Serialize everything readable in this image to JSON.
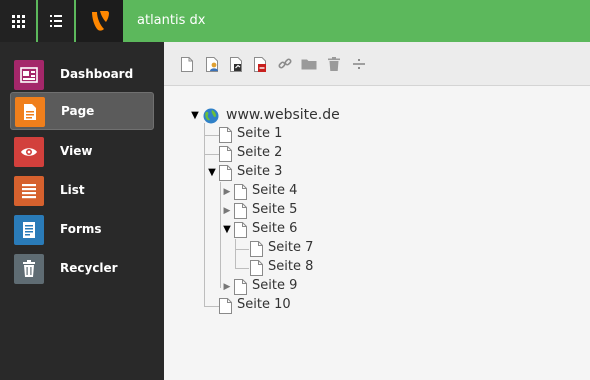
{
  "topbar": {
    "site_name": "atlantis dx",
    "grid_icon": "module-grid-icon",
    "list_icon": "list-icon",
    "logo": "typo3-logo"
  },
  "sidebar": {
    "items": [
      {
        "label": "Dashboard",
        "icon": "dashboard-icon",
        "color": "#a4276a",
        "active": false
      },
      {
        "label": "Page",
        "icon": "page-icon",
        "color": "#f07f1c",
        "active": true
      },
      {
        "label": "View",
        "icon": "eye-icon",
        "color": "#d2403c",
        "active": false
      },
      {
        "label": "List",
        "icon": "list-icon",
        "color": "#d6612e",
        "active": false
      },
      {
        "label": "Forms",
        "icon": "forms-icon",
        "color": "#2a7bb8",
        "active": false
      },
      {
        "label": "Recycler",
        "icon": "trash-icon",
        "color": "#5f6c73",
        "active": false
      }
    ]
  },
  "toolbar": {
    "tools": [
      "new-page-icon",
      "new-page-user-icon",
      "move-page-icon",
      "delete-page-icon",
      "link-icon",
      "folder-icon",
      "trash-icon",
      "separator-icon"
    ]
  },
  "tree": {
    "root": {
      "label": "www.website.de",
      "icon": "globe-icon",
      "expanded": true
    },
    "nodes": [
      {
        "label": "Seite 1",
        "depth": 1,
        "toggle": "none"
      },
      {
        "label": "Seite 2",
        "depth": 1,
        "toggle": "none"
      },
      {
        "label": "Seite 3",
        "depth": 1,
        "toggle": "open"
      },
      {
        "label": "Seite 4",
        "depth": 2,
        "toggle": "closed"
      },
      {
        "label": "Seite 5",
        "depth": 2,
        "toggle": "closed"
      },
      {
        "label": "Seite 6",
        "depth": 2,
        "toggle": "open"
      },
      {
        "label": "Seite 7",
        "depth": 3,
        "toggle": "none"
      },
      {
        "label": "Seite 8",
        "depth": 3,
        "toggle": "none"
      },
      {
        "label": "Seite 9",
        "depth": 2,
        "toggle": "closed"
      },
      {
        "label": "Seite 10",
        "depth": 1,
        "toggle": "none"
      }
    ]
  },
  "colors": {
    "topbar_green": "#5cb85c",
    "sidebar_bg": "#292929",
    "content_bg": "#f5f5f5",
    "typo3_orange": "#ff8700"
  }
}
